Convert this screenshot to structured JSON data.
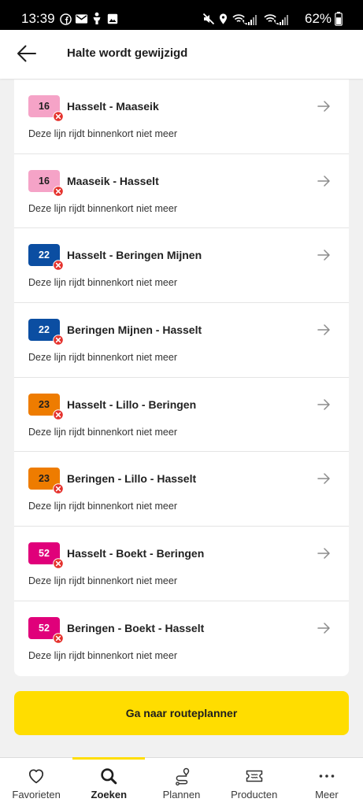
{
  "status_bar": {
    "time": "13:39",
    "battery_percent": "62%",
    "notification_icons": [
      "facebook-icon",
      "mail-icon",
      "person-icon",
      "image-icon"
    ],
    "system_icons": [
      "mute-icon",
      "location-icon",
      "wifi-calling-icon",
      "signal-icon",
      "wifi-calling-icon",
      "signal-icon",
      "battery-icon"
    ]
  },
  "header": {
    "back_icon": "arrow-left-icon",
    "title": "Halte wordt gewijzigd"
  },
  "lines": [
    {
      "number": "16",
      "badge_bg": "#F5A3C7",
      "badge_fg": "#1e1e1e",
      "route": "Hasselt - Maaseik",
      "notice": "Deze lijn rijdt binnenkort niet meer",
      "status_icon": "cancelled-icon",
      "action_icon": "arrow-right-icon"
    },
    {
      "number": "16",
      "badge_bg": "#F5A3C7",
      "badge_fg": "#1e1e1e",
      "route": "Maaseik - Hasselt",
      "notice": "Deze lijn rijdt binnenkort niet meer",
      "status_icon": "cancelled-icon",
      "action_icon": "arrow-right-icon"
    },
    {
      "number": "22",
      "badge_bg": "#0B4EA2",
      "badge_fg": "#ffffff",
      "route": "Hasselt - Beringen Mijnen",
      "notice": "Deze lijn rijdt binnenkort niet meer",
      "status_icon": "cancelled-icon",
      "action_icon": "arrow-right-icon"
    },
    {
      "number": "22",
      "badge_bg": "#0B4EA2",
      "badge_fg": "#ffffff",
      "route": "Beringen Mijnen - Hasselt",
      "notice": "Deze lijn rijdt binnenkort niet meer",
      "status_icon": "cancelled-icon",
      "action_icon": "arrow-right-icon"
    },
    {
      "number": "23",
      "badge_bg": "#EE7C00",
      "badge_fg": "#1e1e1e",
      "route": "Hasselt - Lillo - Beringen",
      "notice": "Deze lijn rijdt binnenkort niet meer",
      "status_icon": "cancelled-icon",
      "action_icon": "arrow-right-icon"
    },
    {
      "number": "23",
      "badge_bg": "#EE7C00",
      "badge_fg": "#1e1e1e",
      "route": "Beringen - Lillo - Hasselt",
      "notice": "Deze lijn rijdt binnenkort niet meer",
      "status_icon": "cancelled-icon",
      "action_icon": "arrow-right-icon"
    },
    {
      "number": "52",
      "badge_bg": "#E0007A",
      "badge_fg": "#ffffff",
      "route": "Hasselt - Boekt - Beringen",
      "notice": "Deze lijn rijdt binnenkort niet meer",
      "status_icon": "cancelled-icon",
      "action_icon": "arrow-right-icon"
    },
    {
      "number": "52",
      "badge_bg": "#E0007A",
      "badge_fg": "#ffffff",
      "route": "Beringen - Boekt - Hasselt",
      "notice": "Deze lijn rijdt binnenkort niet meer",
      "status_icon": "cancelled-icon",
      "action_icon": "arrow-right-icon"
    }
  ],
  "cta": {
    "label": "Ga naar routeplanner",
    "color": "#FFDD00"
  },
  "bottom_nav": {
    "accent": "#FFDD00",
    "active_index": 1,
    "items": [
      {
        "label": "Favorieten",
        "icon": "heart-icon"
      },
      {
        "label": "Zoeken",
        "icon": "search-icon"
      },
      {
        "label": "Plannen",
        "icon": "route-icon"
      },
      {
        "label": "Producten",
        "icon": "ticket-icon"
      },
      {
        "label": "Meer",
        "icon": "more-dots-icon"
      }
    ]
  }
}
